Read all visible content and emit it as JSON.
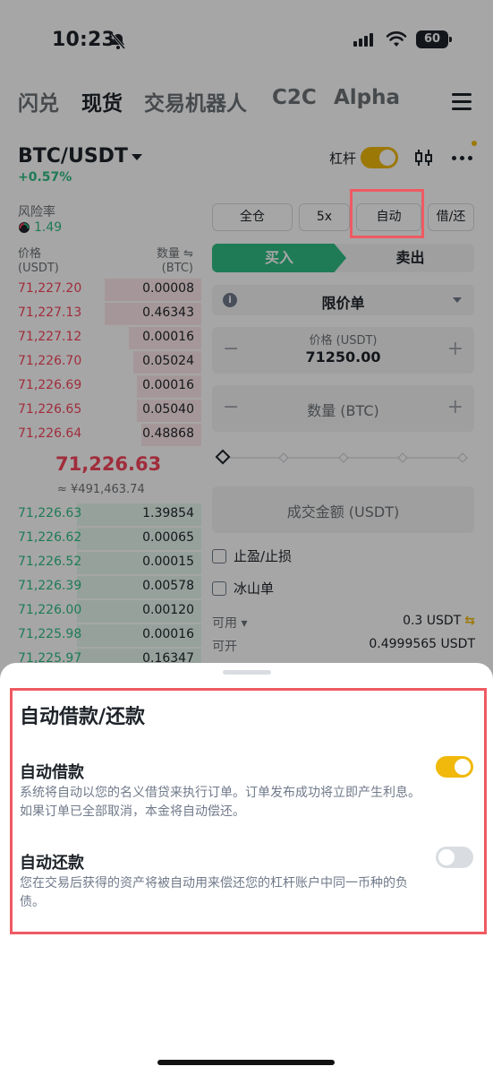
{
  "status_bar": {
    "time": "10:23",
    "battery": "60"
  },
  "top_nav": {
    "tabs": [
      "闪兑",
      "现货",
      "交易机器人",
      "C2C",
      "Alpha"
    ],
    "active": "现货"
  },
  "pair_header": {
    "pair": "BTC/USDT",
    "change": "+0.57%",
    "leverage_label": "杠杆"
  },
  "risk": {
    "label": "风险率",
    "value": "1.49"
  },
  "order_book": {
    "price_header": "价格",
    "price_unit": "(USDT)",
    "qty_header": "数量 ⇋",
    "qty_unit": "(BTC)",
    "asks": [
      {
        "price": "71,227.20",
        "qty": "0.00008",
        "depth": 0.48
      },
      {
        "price": "71,227.13",
        "qty": "0.46343",
        "depth": 0.48
      },
      {
        "price": "71,227.12",
        "qty": "0.00016",
        "depth": 0.36
      },
      {
        "price": "71,226.70",
        "qty": "0.05024",
        "depth": 0.34
      },
      {
        "price": "71,226.69",
        "qty": "0.00016",
        "depth": 0.32
      },
      {
        "price": "71,226.65",
        "qty": "0.05040",
        "depth": 0.32
      },
      {
        "price": "71,226.64",
        "qty": "0.48868",
        "depth": 0.3
      }
    ],
    "last_price": "71,226.63",
    "last_price_fiat": "≈ ¥491,463.74",
    "bids": [
      {
        "price": "71,226.63",
        "qty": "1.39854",
        "depth": 0.62
      },
      {
        "price": "71,226.62",
        "qty": "0.00065",
        "depth": 0.62
      },
      {
        "price": "71,226.52",
        "qty": "0.00015",
        "depth": 0.62
      },
      {
        "price": "71,226.39",
        "qty": "0.00578",
        "depth": 0.62
      },
      {
        "price": "71,226.00",
        "qty": "0.00120",
        "depth": 0.62
      },
      {
        "price": "71,225.98",
        "qty": "0.00016",
        "depth": 0.62
      },
      {
        "price": "71,225.97",
        "qty": "0.16347",
        "depth": 0.62
      }
    ]
  },
  "order_form": {
    "margin_modes": [
      "全仓",
      "5x",
      "自动",
      "借/还"
    ],
    "buy": "买入",
    "sell": "卖出",
    "order_type": "限价单",
    "price_caption": "价格 (USDT)",
    "price_value": "71250.00",
    "qty_placeholder": "数量 (BTC)",
    "total_placeholder": "成交金额 (USDT)",
    "tp_sl": "止盈/止损",
    "iceberg": "冰山单",
    "available_label": "可用 ▾",
    "available_value": "0.3 USDT",
    "open_label": "可开",
    "open_value": "0.4999565 USDT"
  },
  "sheet": {
    "title": "自动借款/还款",
    "auto_borrow": {
      "title": "自动借款",
      "desc": "系统将自动以您的名义借贷来执行订单。订单发布成功将立即产生利息。如果订单已全部取消，本金将自动偿还。",
      "enabled": true
    },
    "auto_repay": {
      "title": "自动还款",
      "desc": "您在交易后获得的资产将被自动用来偿还您的杠杆账户中同一币种的负债。",
      "enabled": false
    }
  },
  "colors": {
    "accent": "#f0b90b",
    "buy": "#2ebd85",
    "sell": "#f6465d",
    "highlight": "#ef5a62"
  }
}
